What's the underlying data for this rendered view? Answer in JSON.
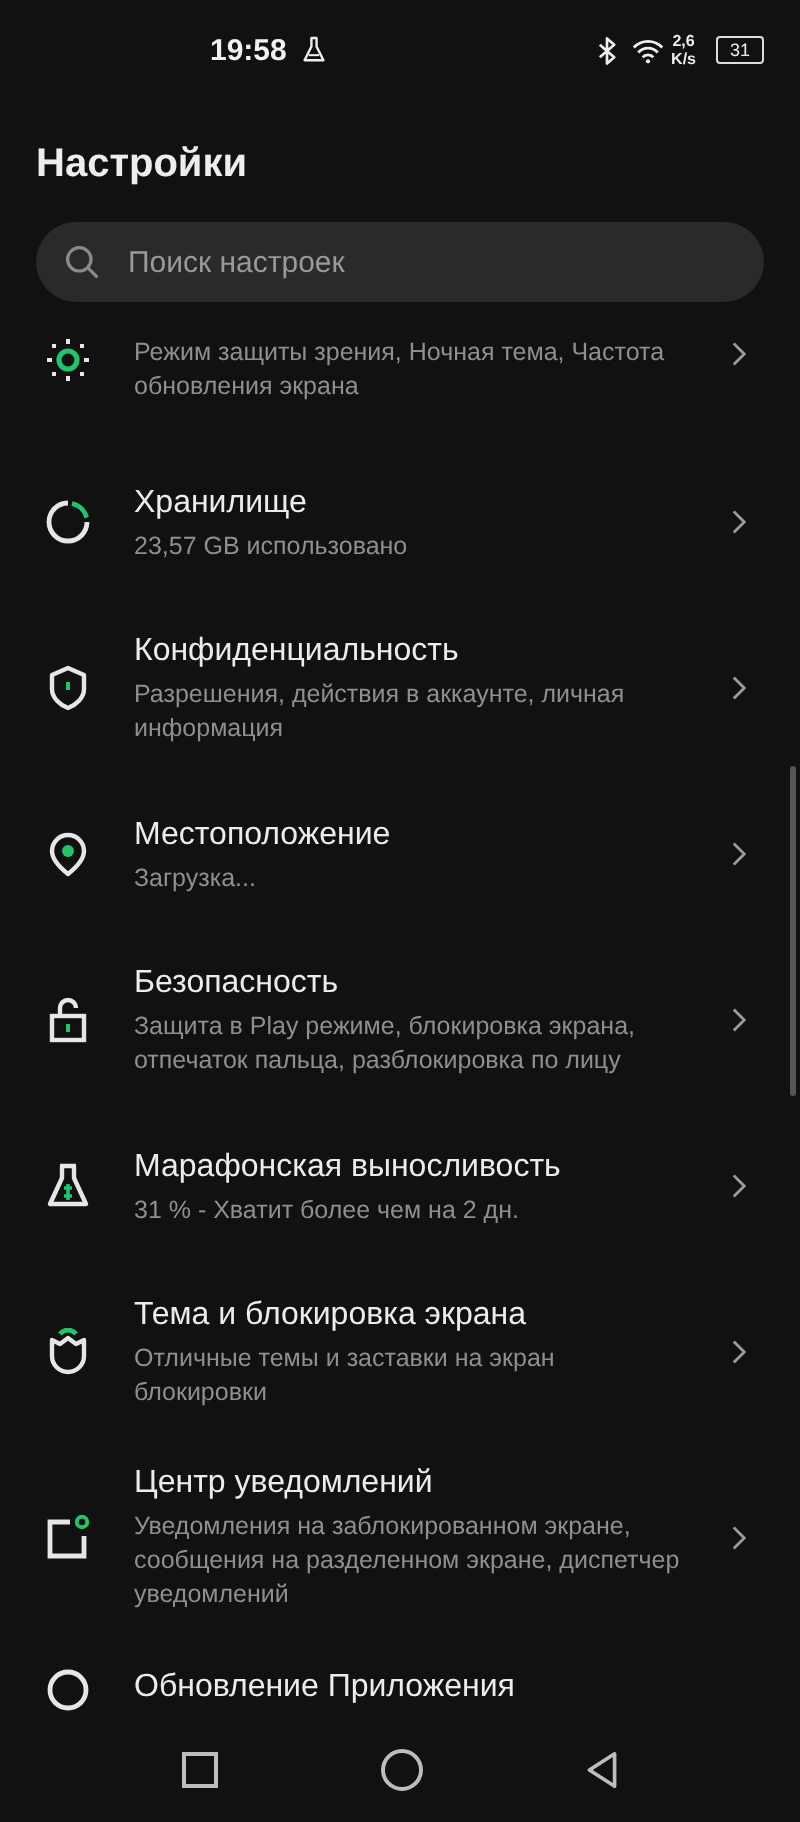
{
  "status_bar": {
    "time": "19:58",
    "net_speed": "2,6",
    "net_unit": "K/s",
    "battery": "31"
  },
  "title": "Настройки",
  "search": {
    "placeholder": "Поиск настроек"
  },
  "items": [
    {
      "subtitle": "Режим защиты зрения, Ночная тема, Частота обновления экрана"
    },
    {
      "title": "Хранилище",
      "subtitle": "23,57 GB использовано"
    },
    {
      "title": "Конфиденциальность",
      "subtitle": "Разрешения, действия в аккаунте, личная информация"
    },
    {
      "title": "Местоположение",
      "subtitle": "Загрузка..."
    },
    {
      "title": "Безопасность",
      "subtitle": "Защита в Play режиме, блокировка экрана, отпечаток пальца, разблокировка по лицу"
    },
    {
      "title": "Марафонская выносливость",
      "subtitle": "31 % - Хватит более чем на 2 дн."
    },
    {
      "title": "Тема и блокировка экрана",
      "subtitle": "Отличные темы и заставки на экран блокировки"
    },
    {
      "title": "Центр уведомлений",
      "subtitle": "Уведомления на заблокированном экране, сообщения на разделенном экране, диспетчер уведомлений"
    },
    {
      "title": "Обновление Приложения"
    }
  ]
}
